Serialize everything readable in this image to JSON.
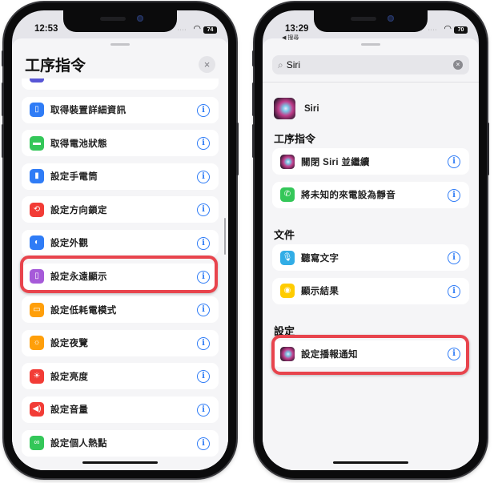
{
  "left_phone": {
    "status": {
      "time": "12:53",
      "battery": "74"
    },
    "sheet_title": "工序指令",
    "close_icon": "×",
    "info_icon": "i",
    "items": [
      {
        "label": "取得裝置詳細資訊",
        "icon": "phone-icon",
        "glyph": "▯",
        "color": "#2f7cf6"
      },
      {
        "label": "取得電池狀態",
        "icon": "battery-icon",
        "glyph": "▬",
        "color": "#34c759"
      },
      {
        "label": "設定手電筒",
        "icon": "flashlight-icon",
        "glyph": "▮",
        "color": "#2f7cf6"
      },
      {
        "label": "設定方向鎖定",
        "icon": "orientation-lock-icon",
        "glyph": "⟲",
        "color": "#f23c36"
      },
      {
        "label": "設定外觀",
        "icon": "appearance-icon",
        "glyph": "◐",
        "color": "#2f7cf6"
      },
      {
        "label": "設定永遠顯示",
        "icon": "always-on-icon",
        "glyph": "▯",
        "color": "#a65ad9"
      },
      {
        "label": "設定低耗電模式",
        "icon": "low-power-icon",
        "glyph": "▭",
        "color": "#ff9f0a"
      },
      {
        "label": "設定夜覽",
        "icon": "night-shift-icon",
        "glyph": "☼",
        "color": "#ff9f0a"
      },
      {
        "label": "設定亮度",
        "icon": "brightness-icon",
        "glyph": "☀",
        "color": "#f23c36"
      },
      {
        "label": "設定音量",
        "icon": "volume-icon",
        "glyph": "◀)",
        "color": "#f23c36"
      },
      {
        "label": "設定個人熱點",
        "icon": "hotspot-icon",
        "glyph": "∞",
        "color": "#34c759"
      }
    ],
    "partial_item_color": "#5856d6",
    "highlighted_item": "設定永遠顯示"
  },
  "right_phone": {
    "status": {
      "time": "13:29",
      "back_label": "◀ 搜尋",
      "battery": "70"
    },
    "search": {
      "icon": "⌕",
      "query": "Siri",
      "clear_icon": "×"
    },
    "app_result": {
      "name": "Siri"
    },
    "info_icon": "i",
    "sections": [
      {
        "title": "工序指令",
        "items": [
          {
            "label": "關閉 Siri 並繼續",
            "icon": "siri-icon",
            "glyph": "",
            "color": "siri"
          },
          {
            "label": "將未知的來電設為靜音",
            "icon": "phone-call-icon",
            "glyph": "✆",
            "color": "#34c759"
          }
        ]
      },
      {
        "title": "文件",
        "items": [
          {
            "label": "聽寫文字",
            "icon": "microphone-icon",
            "glyph": "🎙",
            "color": "#32ade6"
          },
          {
            "label": "顯示結果",
            "icon": "quick-look-icon",
            "glyph": "◉",
            "color": "#ffcc00"
          }
        ]
      },
      {
        "title": "設定",
        "items": [
          {
            "label": "設定播報通知",
            "icon": "siri-icon",
            "glyph": "",
            "color": "siri"
          }
        ]
      }
    ],
    "highlighted_item": "設定播報通知"
  },
  "colors": {
    "accent": "#2f7cf6",
    "highlight": "#e8444d"
  }
}
